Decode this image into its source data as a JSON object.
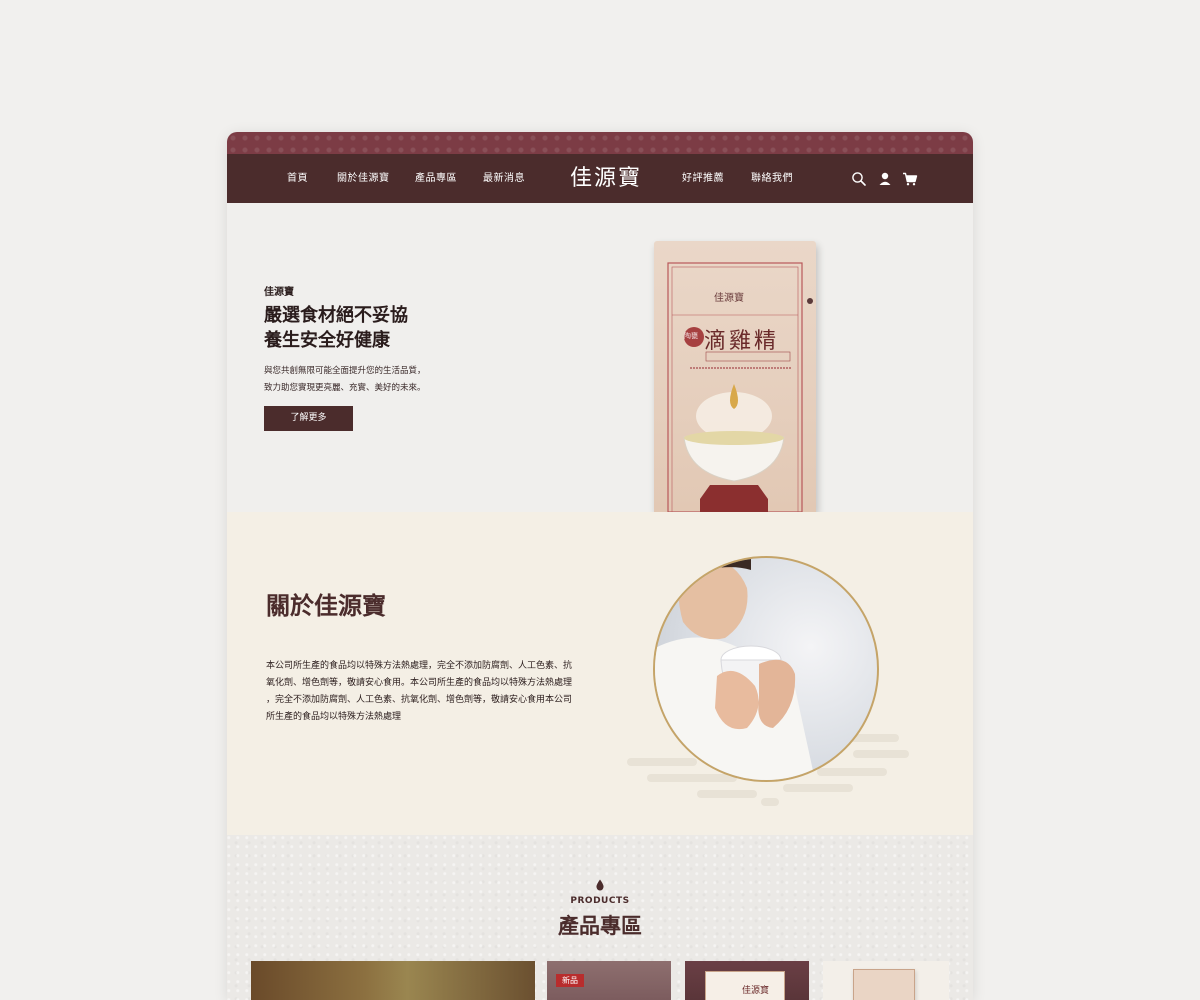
{
  "nav": {
    "left_items": [
      "首頁",
      "關於佳源寶",
      "產品專區",
      "最新消息"
    ],
    "logo": "佳源寶",
    "right_items": [
      "好評推薦",
      "聯絡我們"
    ],
    "icons": [
      "search-icon",
      "user-icon",
      "cart-icon"
    ]
  },
  "hero": {
    "brand": "佳源寶",
    "title_line1": "嚴選食材絕不妥協",
    "title_line2": "養生安全好健康",
    "desc_line1": "與您共創無限可能全面提升您的生活品質，",
    "desc_line2": "致力助您實現更亮麗、充實、美好的未來。",
    "button": "了解更多",
    "package": {
      "brand": "佳源寶",
      "seal": "陶甕",
      "name": "滴雞精"
    }
  },
  "about": {
    "title": "關於佳源寶",
    "text_lines": [
      "本公司所生產的食品均以特殊方法熱處理，完全不添加防腐劑、人工色素、抗",
      "氧化劑、增色劑等，敬請安心食用。本公司所生產的食品均以特殊方法熱處理",
      "，完全不添加防腐劑、人工色素、抗氧化劑、增色劑等，敬請安心食用本公司",
      "所生產的食品均以特殊方法熱處理"
    ]
  },
  "products": {
    "subtitle": "PRODUCTS",
    "title": "產品專區",
    "badge": "新品",
    "box_label": "佳源寶"
  },
  "colors": {
    "brand_dark": "#4b2c2c",
    "strip": "#7c3c45",
    "gold": "#c5a468",
    "about_bg": "#f4efe5",
    "badge": "#b82d2d"
  }
}
